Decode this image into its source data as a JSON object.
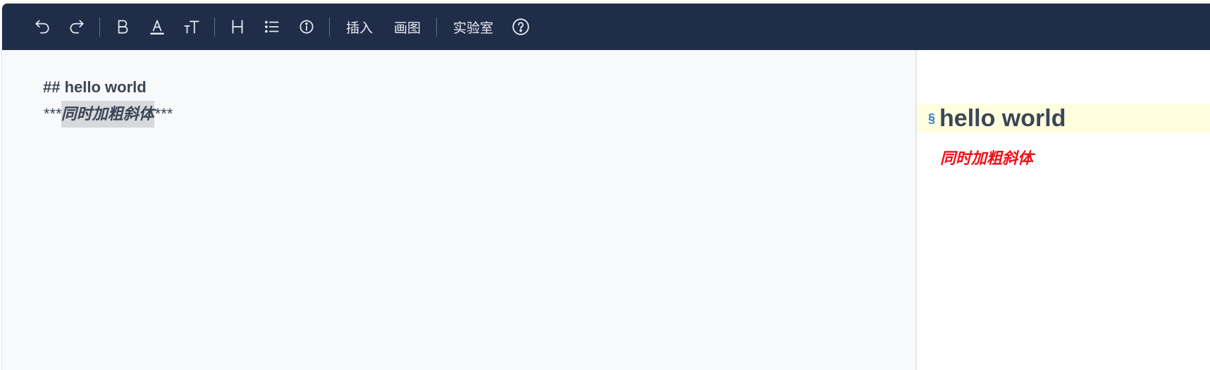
{
  "toolbar": {
    "buttons": [
      {
        "name": "undo",
        "icon": "undo-icon"
      },
      {
        "name": "redo",
        "icon": "redo-icon"
      },
      {
        "name": "bold",
        "icon": "bold-icon"
      },
      {
        "name": "font-color",
        "icon": "font-color-icon"
      },
      {
        "name": "font-size",
        "icon": "font-size-icon"
      },
      {
        "name": "header",
        "icon": "header-icon"
      },
      {
        "name": "list",
        "icon": "list-icon"
      },
      {
        "name": "info",
        "icon": "info-icon"
      },
      {
        "name": "help",
        "icon": "help-icon"
      }
    ],
    "insert_label": "插入",
    "draw_label": "画图",
    "lab_label": "实验室"
  },
  "editor": {
    "line1": "## hello world",
    "line2_prefix": "***",
    "line2_text": "同时加粗斜体",
    "line2_suffix": "***"
  },
  "preview": {
    "anchor": "§",
    "heading": "hello world",
    "emphasis": "同时加粗斜体"
  },
  "colors": {
    "toolbar_bg": "#1f2d49",
    "heading_highlight": "#ffffdf",
    "emphasis_red": "#f40f16",
    "anchor_blue": "#2f7be0"
  }
}
